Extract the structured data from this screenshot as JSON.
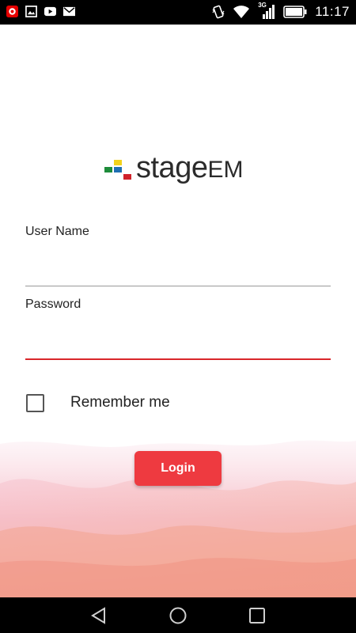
{
  "status_bar": {
    "time": "11:17",
    "network_label": "3G",
    "icons": [
      "vodafone-icon",
      "gallery-icon",
      "youtube-icon",
      "gmail-icon",
      "vibrate-icon",
      "wifi-icon",
      "signal-icon",
      "battery-icon"
    ]
  },
  "logo": {
    "text_main": "stage",
    "text_suffix": "EM",
    "colors": {
      "green": "#1e8c3a",
      "yellow": "#f2d21b",
      "blue": "#1f6fb2",
      "red": "#d0222a"
    }
  },
  "form": {
    "username_label": "User Name",
    "username_value": "",
    "password_label": "Password",
    "password_value": "",
    "remember_label": "Remember me",
    "remember_checked": false,
    "login_label": "Login"
  },
  "colors": {
    "accent": "#ee3a40",
    "focus_underline": "#d9262b"
  },
  "nav_bar": {
    "icons": [
      "back-icon",
      "home-icon",
      "recents-icon"
    ]
  }
}
